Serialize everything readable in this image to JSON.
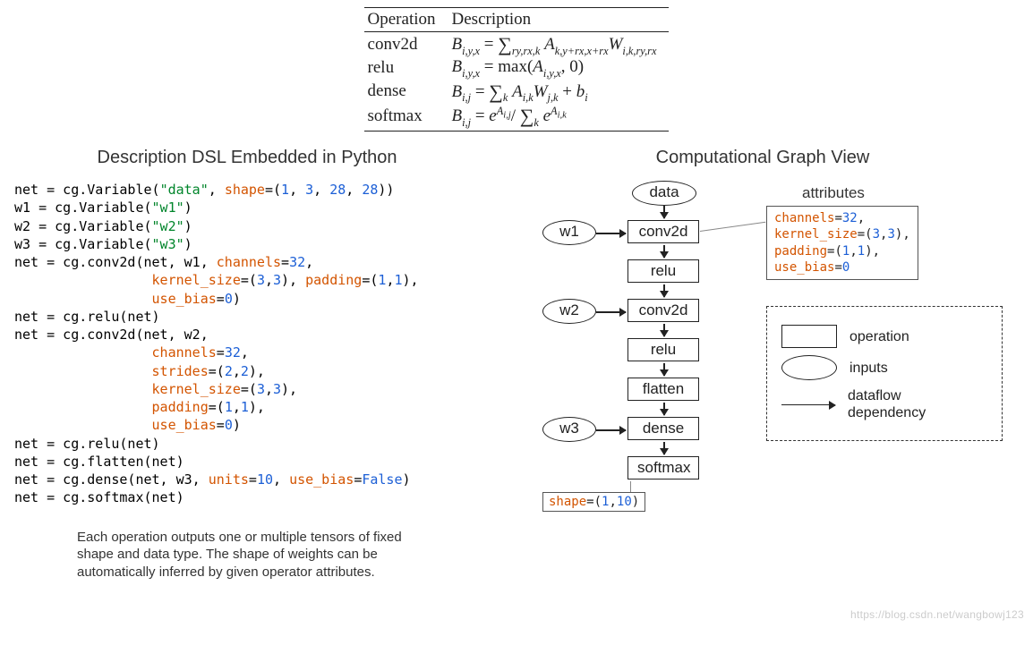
{
  "table": {
    "headers": {
      "op": "Operation",
      "desc": "Description"
    },
    "rows": {
      "conv2d": {
        "op": "conv2d"
      },
      "relu": {
        "op": "relu"
      },
      "dense": {
        "op": "dense"
      },
      "softmax": {
        "op": "softmax"
      }
    }
  },
  "left": {
    "title": "Description DSL Embedded in Python",
    "code": {
      "l1a": "net = cg.Variable(",
      "l1s": "\"data\"",
      "l1b": ", ",
      "l1k": "shape",
      "l1c": "=(",
      "l1n1": "1",
      "l1n2": "3",
      "l1n3": "28",
      "l1n4": "28",
      "l1d": "))",
      "l2a": "w1 = cg.Variable(",
      "l2s": "\"w1\"",
      "l2b": ")",
      "l3a": "w2 = cg.Variable(",
      "l3s": "\"w2\"",
      "l3b": ")",
      "l4a": "w3 = cg.Variable(",
      "l4s": "\"w3\"",
      "l4b": ")",
      "l5a": "net = cg.conv2d(net, w1, ",
      "l5k1": "channels",
      "l5n1": "32",
      "l6pad": "                 ",
      "l6k1": "kernel_size",
      "l6n1": "3",
      "l6n2": "3",
      "l6k2": "padding",
      "l6n3": "1",
      "l6n4": "1",
      "l7pad": "                 ",
      "l7k1": "use_bias",
      "l7n1": "0",
      "l8": "net = cg.relu(net)",
      "l9a": "net = cg.conv2d(net, w2,",
      "l10pad": "                 ",
      "l10k": "channels",
      "l10n": "32",
      "l11pad": "                 ",
      "l11k": "strides",
      "l11n1": "2",
      "l11n2": "2",
      "l12pad": "                 ",
      "l12k": "kernel_size",
      "l12n1": "3",
      "l12n2": "3",
      "l13pad": "                 ",
      "l13k": "padding",
      "l13n1": "1",
      "l13n2": "1",
      "l14pad": "                 ",
      "l14k": "use_bias",
      "l14n": "0",
      "l15": "net = cg.relu(net)",
      "l16": "net = cg.flatten(net)",
      "l17a": "net = cg.dense(net, w3, ",
      "l17k1": "units",
      "l17n1": "10",
      "l17k2": "use_bias",
      "l17b": "False",
      "l18": "net = cg.softmax(net)"
    },
    "note": "Each operation outputs one or multiple tensors of fixed shape and data type. The shape of weights can be automatically inferred by given operator attributes."
  },
  "right": {
    "title": "Computational Graph View",
    "attr_title": "attributes",
    "nodes": {
      "data": "data",
      "w1": "w1",
      "w2": "w2",
      "w3": "w3",
      "conv2d_1": "conv2d",
      "relu_1": "relu",
      "conv2d_2": "conv2d",
      "relu_2": "relu",
      "flatten": "flatten",
      "dense": "dense",
      "softmax": "softmax"
    },
    "attrs": {
      "k1": "channels",
      "v1": "32",
      "k2": "kernel_size",
      "v2a": "3",
      "v2b": "3",
      "k3": "padding",
      "v3a": "1",
      "v3b": "1",
      "k4": "use_bias",
      "v4": "0"
    },
    "shape": {
      "k": "shape",
      "v1": "1",
      "v2": "10"
    },
    "legend": {
      "operation": "operation",
      "inputs": "inputs",
      "dataflow": "dataflow\ndependency"
    }
  },
  "watermark": "https://blog.csdn.net/wangbowj123"
}
